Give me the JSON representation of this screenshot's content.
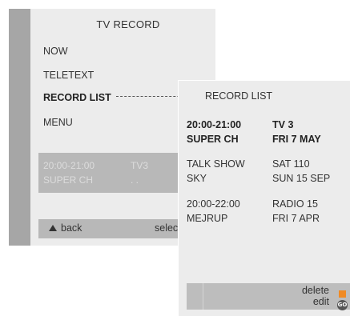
{
  "tv_record": {
    "title": "TV RECORD",
    "menu": [
      {
        "label": "NOW"
      },
      {
        "label": "TELETEXT"
      },
      {
        "label": "RECORD LIST",
        "active": true
      },
      {
        "label": "MENU"
      }
    ],
    "selected": {
      "time": "20:00-21:00",
      "channel": "TV3",
      "name": "SUPER CH",
      "dots": ". ."
    },
    "footer": {
      "back_label": "back",
      "select_label": "selec"
    }
  },
  "record_list": {
    "title": "RECORD LIST",
    "entries": [
      {
        "line1_left": "20:00-21:00",
        "line1_right": "TV 3",
        "line2_left": "SUPER CH",
        "line2_right": "FRI  7  MAY",
        "bold": true
      },
      {
        "line1_left": "TALK SHOW",
        "line1_right": "SAT 110",
        "line2_left": "SKY",
        "line2_right": "SUN  15  SEP",
        "bold": false
      },
      {
        "line1_left": "20:00-22:00",
        "line1_right": "RADIO 15",
        "line2_left": "MEJRUP",
        "line2_right": "FRI  7  APR",
        "bold": false
      }
    ],
    "actions": {
      "delete_label": "delete",
      "edit_label": "edit",
      "go_icon_text": "GO"
    },
    "colors": {
      "accent": "#f08a24"
    }
  }
}
